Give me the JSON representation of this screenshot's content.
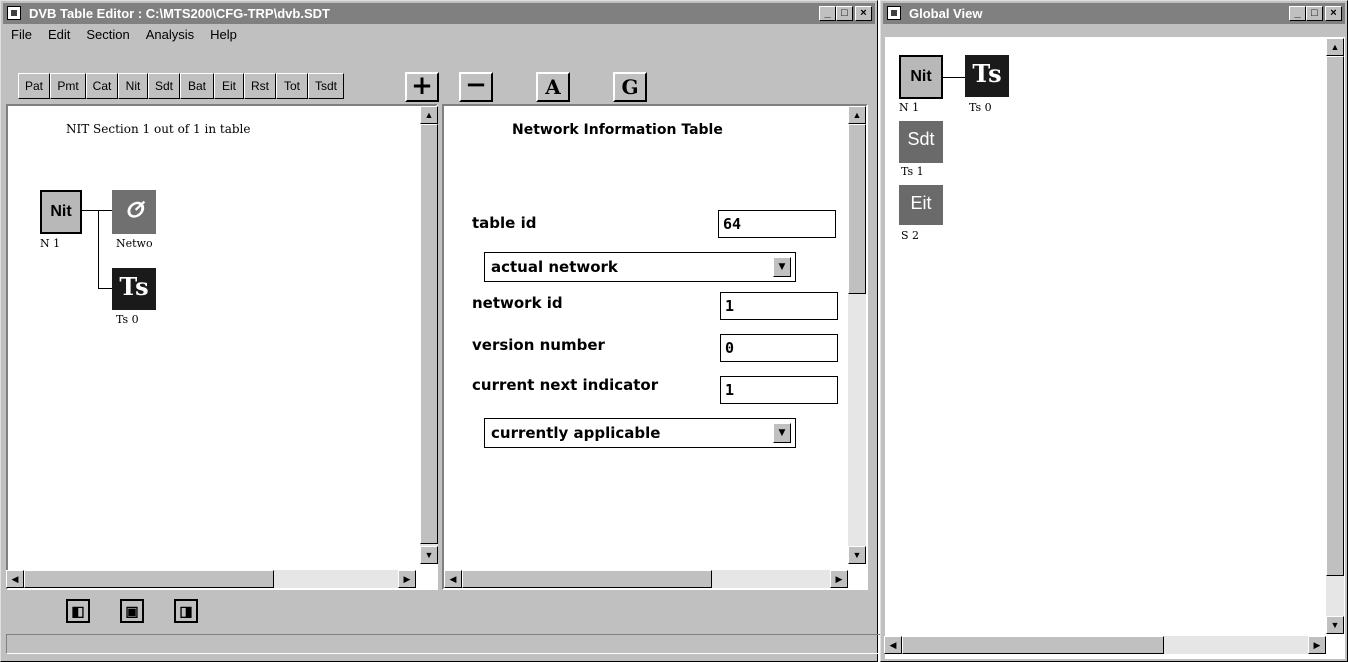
{
  "editor": {
    "title": "DVB Table Editor : C:\\MTS200\\CFG-TRP\\dvb.SDT",
    "menu": [
      "File",
      "Edit",
      "Section",
      "Analysis",
      "Help"
    ],
    "table_tabs": [
      "Pat",
      "Pmt",
      "Cat",
      "Nit",
      "Sdt",
      "Bat",
      "Eit",
      "Rst",
      "Tot",
      "Tsdt"
    ],
    "tool_buttons": {
      "add": "+",
      "remove": "−",
      "a": "A",
      "g": "G"
    },
    "tree": {
      "header": "NIT Section 1 out of 1 in table",
      "nit_label": "Nit",
      "nit_caption": "N 1",
      "network_caption": "Netwo",
      "ts_label": "Ts",
      "ts_caption": "Ts 0"
    },
    "form": {
      "title": "Network Information Table",
      "table_id_label": "table id",
      "table_id_value": "64",
      "network_type_option": "actual network",
      "network_id_label": "network id",
      "network_id_value": "1",
      "version_label": "version number",
      "version_value": "0",
      "current_next_label": "current next indicator",
      "current_next_value": "1",
      "applicability_option": "currently applicable"
    }
  },
  "global_view": {
    "title": "Global View",
    "nodes": {
      "nit_label": "Nit",
      "nit_caption": "N 1",
      "ts_label": "Ts",
      "ts_caption": "Ts 0",
      "sdt_label": "Sdt",
      "sdt_caption": "Ts 1",
      "eit_label": "Eit",
      "eit_caption": "S 2"
    }
  },
  "colors": {
    "titlebar": "#808080",
    "window": "#c0c0c0"
  }
}
